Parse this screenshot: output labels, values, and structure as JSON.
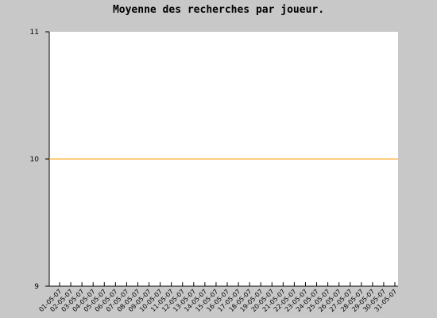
{
  "chart_data": {
    "type": "line",
    "title": "Moyenne des recherches par joueur.",
    "xlabel": "",
    "ylabel": "",
    "ylim": [
      9,
      11
    ],
    "yticks": [
      "11",
      "10",
      "9"
    ],
    "grid": false,
    "categories": [
      "01-05-07",
      "02-05-07",
      "03-05-07",
      "04-05-07",
      "05-05-07",
      "06-05-07",
      "07-05-07",
      "08-05-07",
      "09-05-07",
      "10-05-07",
      "11-05-07",
      "12-05-07",
      "13-05-07",
      "14-05-07",
      "15-05-07",
      "16-05-07",
      "17-05-07",
      "18-05-07",
      "19-05-07",
      "20-05-07",
      "21-05-07",
      "22-05-07",
      "23-05-07",
      "24-05-07",
      "25-05-07",
      "26-05-07",
      "27-05-07",
      "28-05-07",
      "29-05-07",
      "30-05-07",
      "31-05-07"
    ],
    "series": [
      {
        "values": [
          10,
          10,
          10,
          10,
          10,
          10,
          10,
          10,
          10,
          10,
          10,
          10,
          10,
          10,
          10,
          10,
          10,
          10,
          10,
          10,
          10,
          10,
          10,
          10,
          10,
          10,
          10,
          10,
          10,
          10,
          10
        ],
        "color": "#ff9900"
      }
    ]
  }
}
